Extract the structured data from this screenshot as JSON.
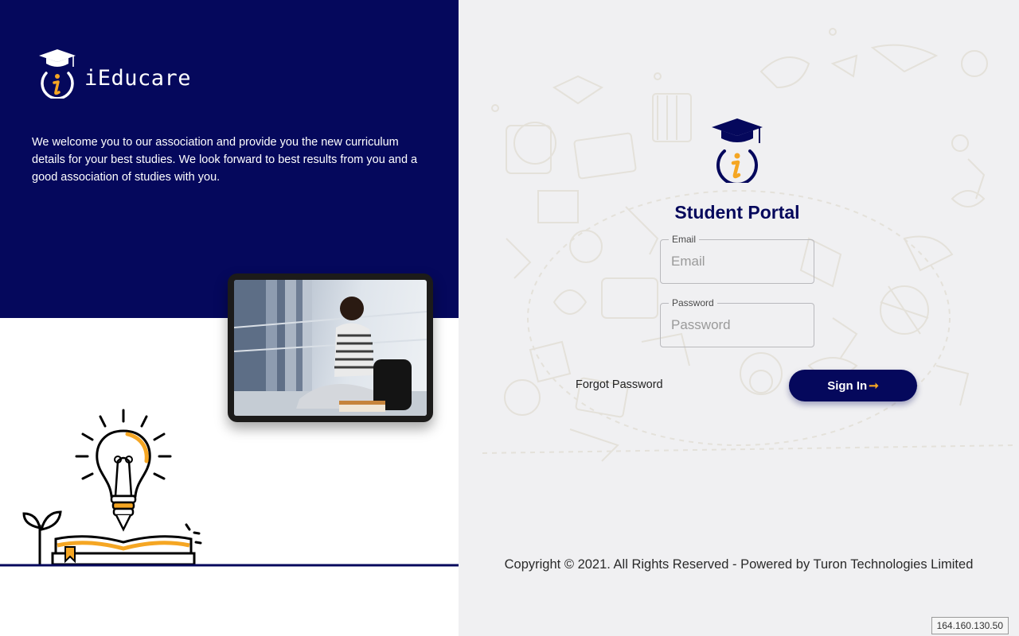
{
  "brand": {
    "name": "iEducare",
    "welcome_text": "We welcome you to our association and provide you the new curriculum details for your best studies. We look forward to best results from you and a good association of studies with you."
  },
  "login": {
    "title": "Student Portal",
    "email_label": "Email",
    "email_placeholder": "Email",
    "password_label": "Password",
    "password_placeholder": "Password",
    "forgot_label": "Forgot Password",
    "signin_label": "Sign In",
    "signin_arrow": "➞"
  },
  "footer": {
    "copyright": "Copyright © 2021. All Rights Reserved - Powered by Turon Technologies Limited"
  },
  "status": {
    "ip": "164.160.130.50"
  },
  "icons": {
    "logo": "graduation-cap-info-icon",
    "signin_arrow": "arrow-right-icon"
  },
  "colors": {
    "primary": "#05085c",
    "accent": "#f5a623",
    "background": "#f0f0f2"
  }
}
